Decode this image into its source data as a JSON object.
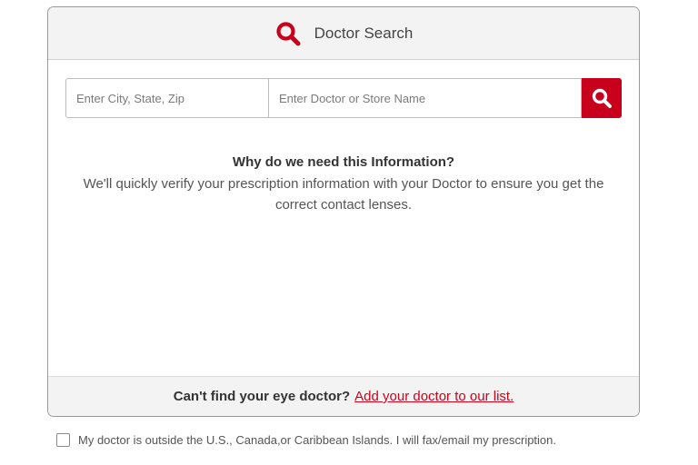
{
  "header": {
    "title": "Doctor Search",
    "icon": "search-icon",
    "icon_color": "#c8001b"
  },
  "search": {
    "location_placeholder": "Enter City, State, Zip",
    "location_value": "",
    "doctor_placeholder": "Enter Doctor or Store Name",
    "doctor_value": "",
    "button_icon": "search-icon",
    "button_color": "#c8001b"
  },
  "info": {
    "heading": "Why do we need this Information?",
    "body": "We'll quickly verify your prescription information with your Doctor to ensure you get the correct contact lenses."
  },
  "footer": {
    "text": "Can't find your eye doctor?",
    "link_text": "Add your doctor to our list.",
    "link_color": "#d0021b"
  },
  "outside_option": {
    "label": "My doctor is outside the U.S., Canada,or Caribbean Islands. I will fax/email my prescription.",
    "checked": false
  }
}
